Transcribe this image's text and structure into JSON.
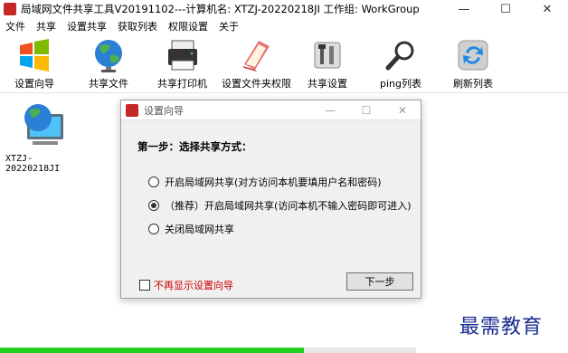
{
  "window": {
    "title": "局域网文件共享工具V20191102---计算机名: XTZJ-20220218JI  工作组: WorkGroup",
    "minimize": "—",
    "maximize": "☐",
    "close": "✕"
  },
  "menu": [
    "文件",
    "共享",
    "设置共享",
    "获取列表",
    "权限设置",
    "关于"
  ],
  "toolbar": [
    {
      "label": "设置向导",
      "icon": "windows-logo-icon"
    },
    {
      "label": "共享文件",
      "icon": "globe-icon"
    },
    {
      "label": "共享打印机",
      "icon": "printer-icon"
    },
    {
      "label": "设置文件夹权限",
      "icon": "folder-book-icon"
    },
    {
      "label": "共享设置",
      "icon": "tools-icon"
    },
    {
      "label": "ping列表",
      "icon": "magnifier-icon"
    },
    {
      "label": "刷新列表",
      "icon": "refresh-icon"
    }
  ],
  "computers": [
    {
      "name": "XTZJ-20220218JI"
    }
  ],
  "dialog": {
    "title": "设置向导",
    "minimize": "—",
    "maximize": "☐",
    "close": "✕",
    "step": "第一步：选择共享方式：",
    "options": [
      {
        "label": "开启局域网共享(对方访问本机要填用户名和密码)",
        "selected": false
      },
      {
        "label": "（推荐）开启局域网共享(访问本机不输入密码即可进入)",
        "selected": true
      },
      {
        "label": "关闭局域网共享",
        "selected": false
      }
    ],
    "dont_show": "不再显示设置向导",
    "next": "下一步"
  },
  "watermark": "最需教育",
  "progress": 0.73,
  "colors": {
    "accent_red": "#d00000",
    "progress": "#21d021",
    "watermark": "#1a2c8f"
  }
}
